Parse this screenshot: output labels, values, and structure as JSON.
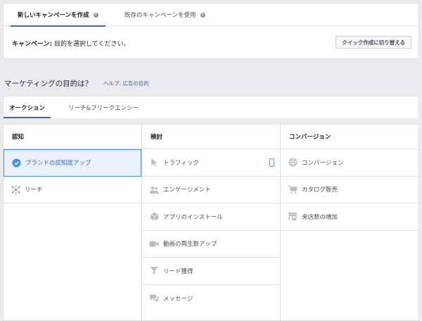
{
  "tabs": [
    {
      "label": "新しいキャンペーンを作成"
    },
    {
      "label": "既存のキャンペーンを使用"
    }
  ],
  "campaign": {
    "prefix": "キャンペーン:",
    "text": " 目的を選択してください。"
  },
  "quick_button": "クイック作成に切り替える",
  "objective": {
    "heading": "マーケティングの目的は？",
    "help_prefix": "ヘルプ: ",
    "help_link": "広告の目的"
  },
  "objective_tabs": [
    {
      "label": "オークション"
    },
    {
      "label": "リーチ&フリークエンシー"
    }
  ],
  "columns": [
    {
      "header": "認知",
      "items": [
        {
          "label": "ブランドの認知度アップ",
          "icon": "check-circle-icon",
          "selected": true
        },
        {
          "label": "リーチ",
          "icon": "reach-icon"
        }
      ]
    },
    {
      "header": "検討",
      "items": [
        {
          "label": "トラフィック",
          "icon": "cursor-icon",
          "mobile": true
        },
        {
          "label": "エンゲージメント",
          "icon": "people-icon"
        },
        {
          "label": "アプリのインストール",
          "icon": "box-icon"
        },
        {
          "label": "動画の再生数アップ",
          "icon": "video-icon"
        },
        {
          "label": "リード獲得",
          "icon": "funnel-icon"
        },
        {
          "label": "メッセージ",
          "icon": "chat-icon"
        }
      ]
    },
    {
      "header": "コンバージョン",
      "items": [
        {
          "label": "コンバージョン",
          "icon": "globe-icon"
        },
        {
          "label": "カタログ販売",
          "icon": "cart-icon"
        },
        {
          "label": "来店数の増加",
          "icon": "store-icon"
        }
      ]
    }
  ],
  "colors": {
    "accent": "#4267b2",
    "selected_bg": "#eaf1fb",
    "selected_border": "#4b8ee5"
  }
}
